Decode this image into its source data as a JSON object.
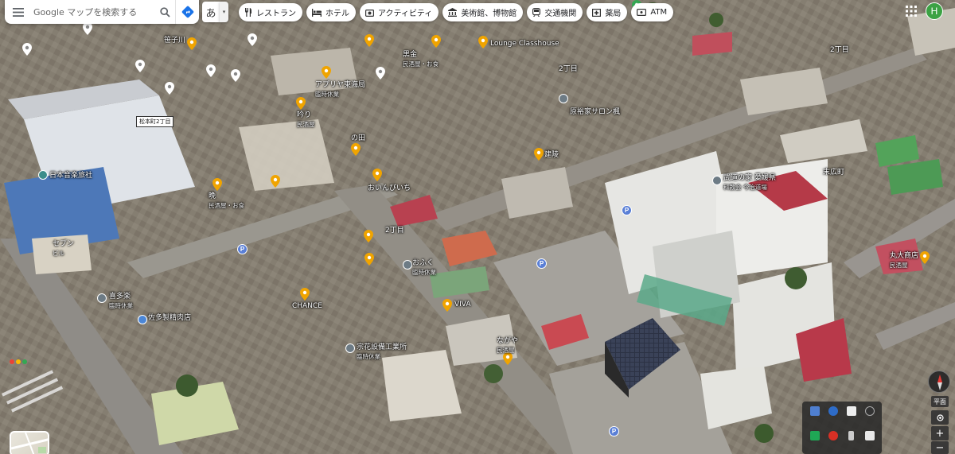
{
  "search": {
    "placeholder": "Google マップを検索する"
  },
  "ime": {
    "label": "あ",
    "dropdown": "▾"
  },
  "chips": [
    {
      "label": "レストラン",
      "icon": "fork-knife-icon"
    },
    {
      "label": "ホテル",
      "icon": "bed-icon"
    },
    {
      "label": "アクティビティ",
      "icon": "camera-icon"
    },
    {
      "label": "美術館、博物館",
      "icon": "museum-icon"
    },
    {
      "label": "交通機関",
      "icon": "train-icon"
    },
    {
      "label": "薬局",
      "icon": "pharmacy-icon"
    },
    {
      "label": "ATM",
      "icon": "atm-icon"
    }
  ],
  "account": {
    "initial": "H",
    "color": "#3ca244"
  },
  "street_sign": "松本町2丁目",
  "labels": {
    "sanuki": "笹子川",
    "pharmacy": "アプリヤ東海局",
    "pharmacy_sub": "臨時休業",
    "kurokin": "黒金",
    "kurokin_sub": "民酒屋・お食",
    "lounge": "Lounge Classhouse",
    "chome2": "2丁目",
    "chome2b": "2丁目",
    "chome2c": "2丁目",
    "izakaya1": "吟り",
    "izakaya1_sub": "民酒屋",
    "tanada": "の田",
    "nippon": "日本音楽旅社",
    "shitou": "晩",
    "shitou_sub": "民酒屋・お食",
    "oikawa": "おいんびいち",
    "salon": "原裕家サロン楓",
    "kenryu": "建陵",
    "bukaku": "武道の家 愛媛県",
    "bukaku_sub": "科教会 今治道場",
    "suetsugu": "末広町",
    "marudai": "丸大商店",
    "marudai_sub": "民酒屋",
    "ofuku": "おふく",
    "ofuku_sub": "臨時休業",
    "chance": "CHANCE",
    "viva": "VIVA",
    "kitakaze": "喜多楽",
    "kitakaze_sub": "臨時休業",
    "sakata": "佐多製精肉店",
    "nagaya": "ながや",
    "nagaya_sub": "民酒屋",
    "miyake": "宗花設備工業所",
    "miyake_sub": "臨時休業",
    "seven": "セブン",
    "seven_sub": "ビル"
  },
  "view": {
    "mode_label": "平面",
    "zoom_in": "+",
    "zoom_out": "−"
  }
}
